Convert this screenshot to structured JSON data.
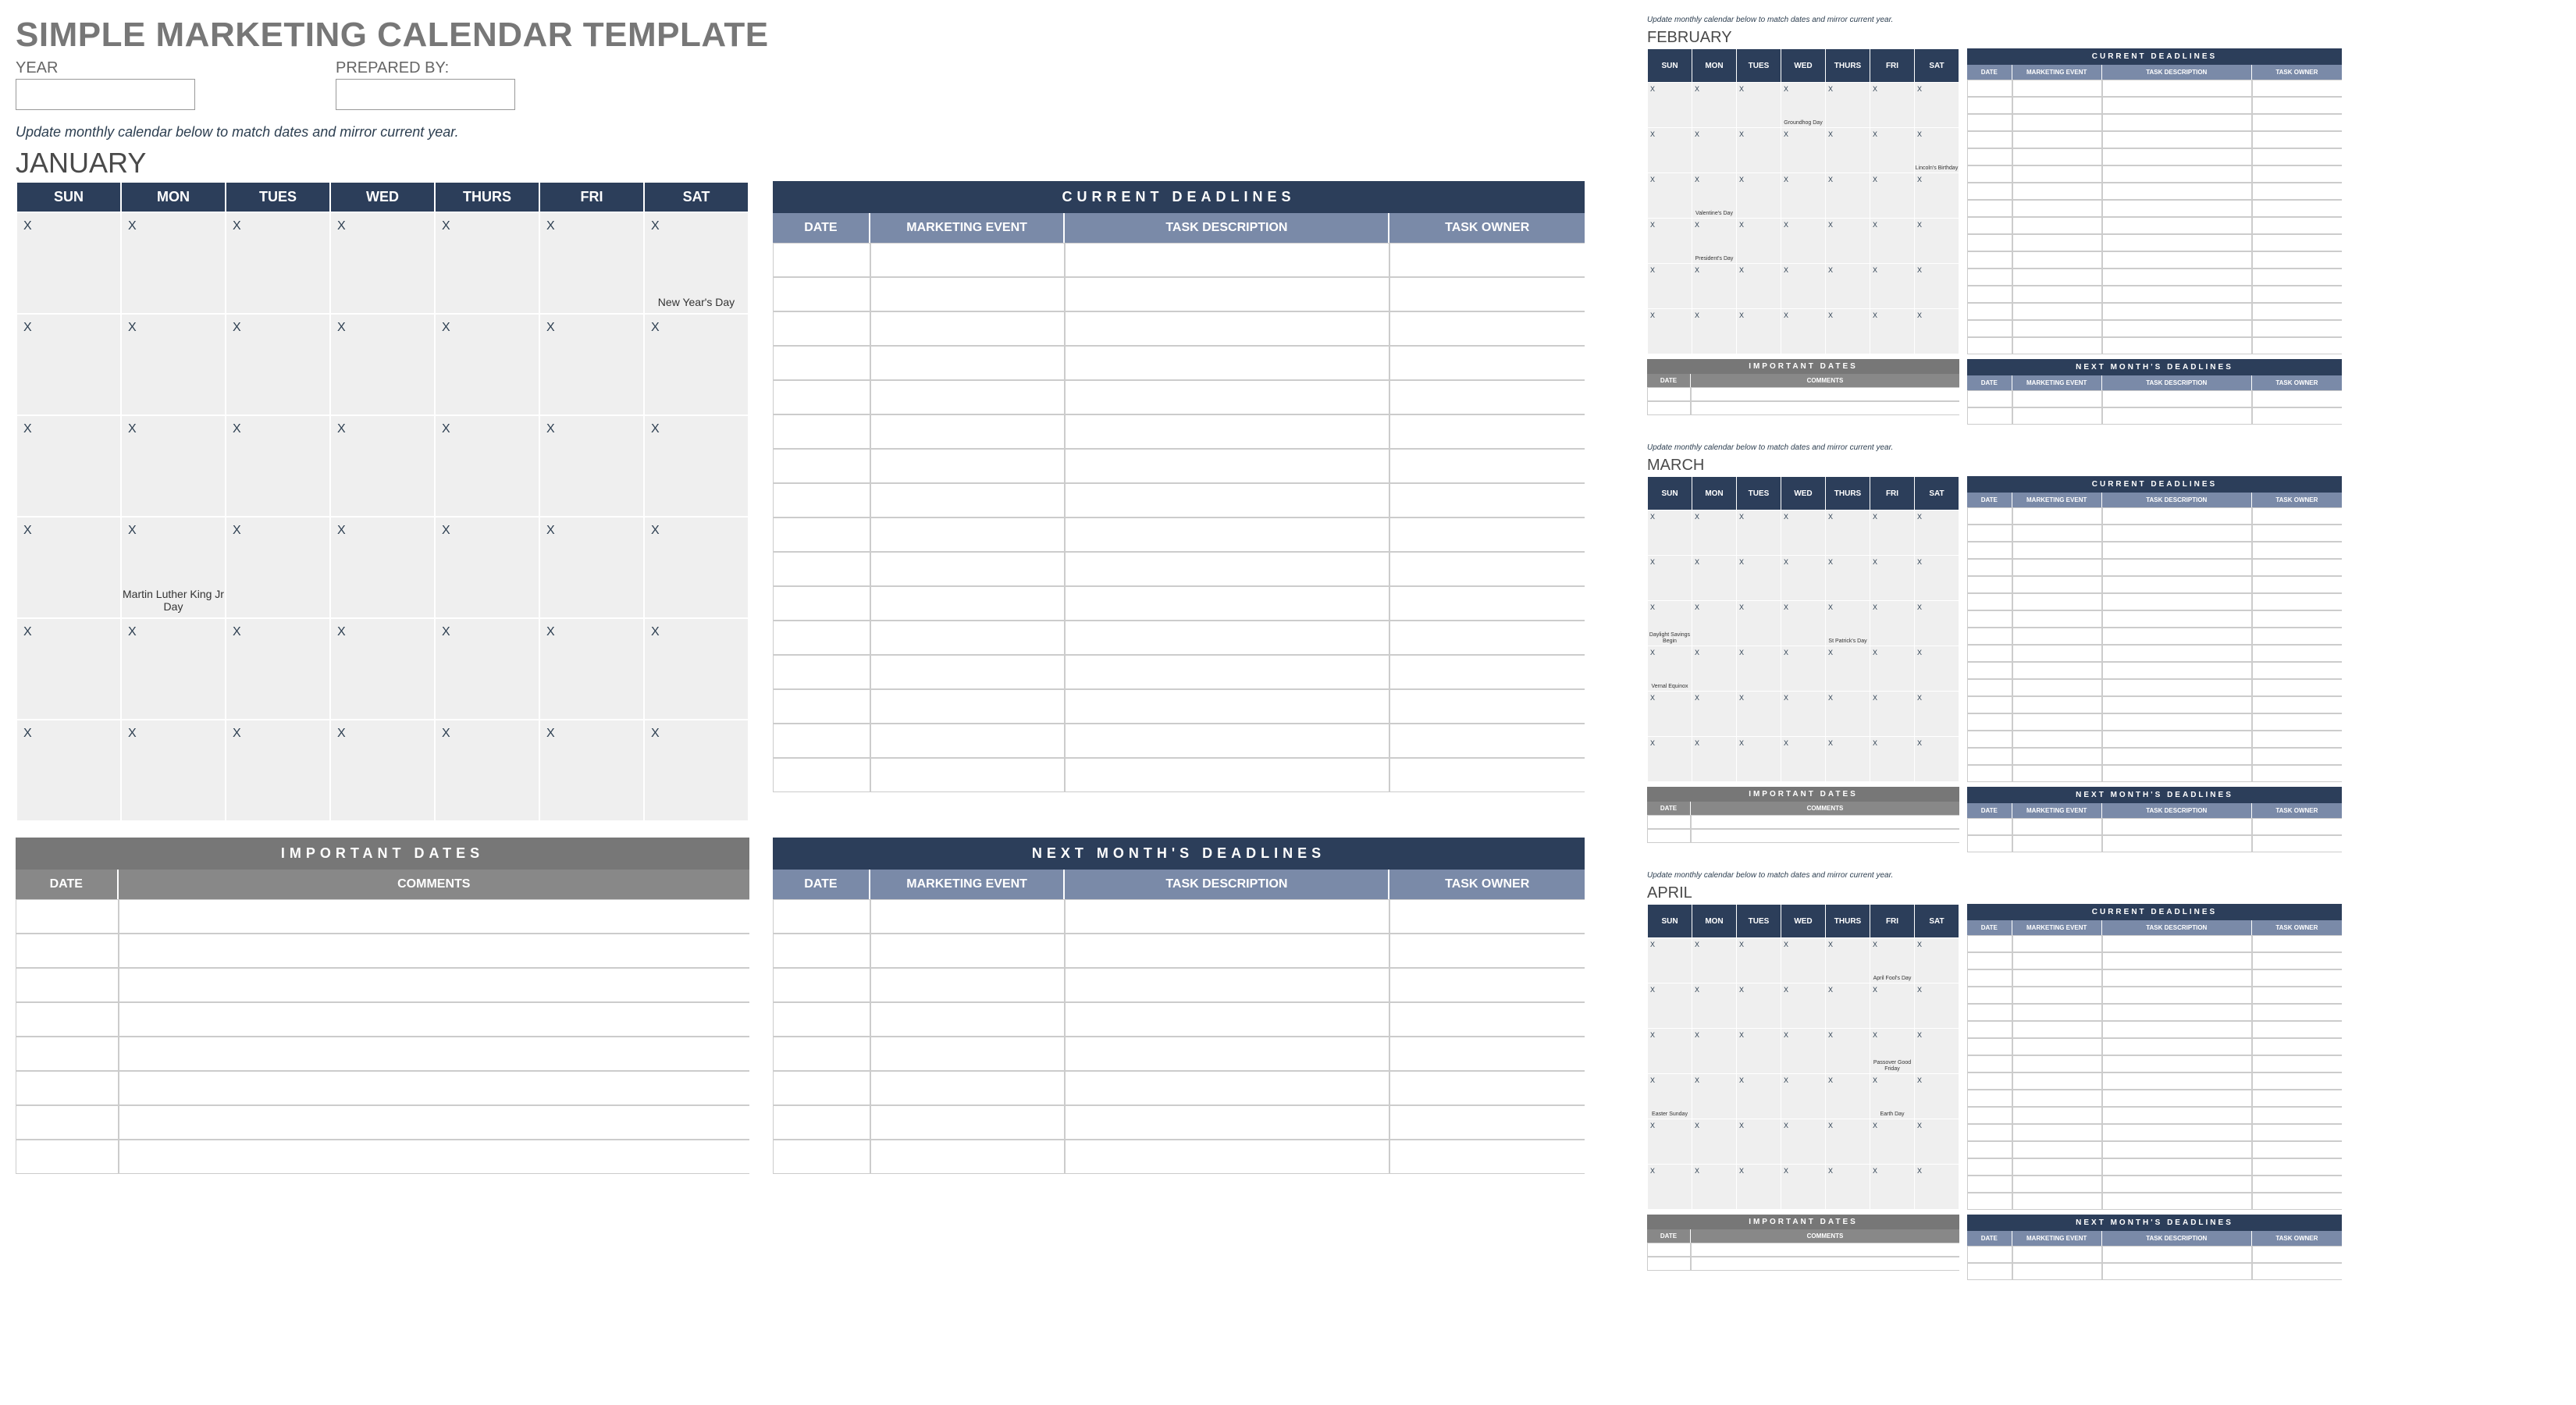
{
  "title": "SIMPLE MARKETING CALENDAR TEMPLATE",
  "meta": {
    "year_label": "YEAR",
    "year_value": "",
    "prepared_label": "PREPARED BY:",
    "prepared_value": ""
  },
  "instruction": "Update monthly calendar below to match dates and mirror current year.",
  "day_headers": [
    "SUN",
    "MON",
    "TUES",
    "WED",
    "THURS",
    "FRI",
    "SAT"
  ],
  "panel_labels": {
    "current_deadlines": "CURRENT DEADLINES",
    "next_month_deadlines": "NEXT MONTH'S DEADLINES",
    "important_dates": "IMPORTANT DATES",
    "date": "DATE",
    "marketing_event": "MARKETING EVENT",
    "task_description": "TASK DESCRIPTION",
    "task_owner": "TASK OWNER",
    "comments": "COMMENTS"
  },
  "main_month": {
    "name": "JANUARY",
    "weeks": [
      [
        {
          "m": "X"
        },
        {
          "m": "X"
        },
        {
          "m": "X"
        },
        {
          "m": "X"
        },
        {
          "m": "X"
        },
        {
          "m": "X"
        },
        {
          "m": "X",
          "ev": "New Year's Day"
        }
      ],
      [
        {
          "m": "X"
        },
        {
          "m": "X"
        },
        {
          "m": "X"
        },
        {
          "m": "X"
        },
        {
          "m": "X"
        },
        {
          "m": "X"
        },
        {
          "m": "X"
        }
      ],
      [
        {
          "m": "X"
        },
        {
          "m": "X"
        },
        {
          "m": "X"
        },
        {
          "m": "X"
        },
        {
          "m": "X"
        },
        {
          "m": "X"
        },
        {
          "m": "X"
        }
      ],
      [
        {
          "m": "X"
        },
        {
          "m": "X",
          "ev": "Martin Luther King Jr Day"
        },
        {
          "m": "X"
        },
        {
          "m": "X"
        },
        {
          "m": "X"
        },
        {
          "m": "X"
        },
        {
          "m": "X"
        }
      ],
      [
        {
          "m": "X"
        },
        {
          "m": "X"
        },
        {
          "m": "X"
        },
        {
          "m": "X"
        },
        {
          "m": "X"
        },
        {
          "m": "X"
        },
        {
          "m": "X"
        }
      ],
      [
        {
          "m": "X"
        },
        {
          "m": "X"
        },
        {
          "m": "X"
        },
        {
          "m": "X"
        },
        {
          "m": "X"
        },
        {
          "m": "X"
        },
        {
          "m": "X"
        }
      ]
    ]
  },
  "mini_months": [
    {
      "name": "FEBRUARY",
      "weeks": [
        [
          {
            "m": "X"
          },
          {
            "m": "X"
          },
          {
            "m": "X"
          },
          {
            "m": "X",
            "ev": "Groundhog Day"
          },
          {
            "m": "X"
          },
          {
            "m": "X"
          },
          {
            "m": "X"
          }
        ],
        [
          {
            "m": "X"
          },
          {
            "m": "X"
          },
          {
            "m": "X"
          },
          {
            "m": "X"
          },
          {
            "m": "X"
          },
          {
            "m": "X"
          },
          {
            "m": "X",
            "ev": "Lincoln's Birthday"
          }
        ],
        [
          {
            "m": "X"
          },
          {
            "m": "X",
            "ev": "Valentine's Day"
          },
          {
            "m": "X"
          },
          {
            "m": "X"
          },
          {
            "m": "X"
          },
          {
            "m": "X"
          },
          {
            "m": "X"
          }
        ],
        [
          {
            "m": "X"
          },
          {
            "m": "X",
            "ev": "President's Day"
          },
          {
            "m": "X"
          },
          {
            "m": "X"
          },
          {
            "m": "X"
          },
          {
            "m": "X"
          },
          {
            "m": "X"
          }
        ],
        [
          {
            "m": "X"
          },
          {
            "m": "X"
          },
          {
            "m": "X"
          },
          {
            "m": "X"
          },
          {
            "m": "X"
          },
          {
            "m": "X"
          },
          {
            "m": "X"
          }
        ],
        [
          {
            "m": "X"
          },
          {
            "m": "X"
          },
          {
            "m": "X"
          },
          {
            "m": "X"
          },
          {
            "m": "X"
          },
          {
            "m": "X"
          },
          {
            "m": "X"
          }
        ]
      ]
    },
    {
      "name": "MARCH",
      "weeks": [
        [
          {
            "m": "X"
          },
          {
            "m": "X"
          },
          {
            "m": "X"
          },
          {
            "m": "X"
          },
          {
            "m": "X"
          },
          {
            "m": "X"
          },
          {
            "m": "X"
          }
        ],
        [
          {
            "m": "X"
          },
          {
            "m": "X"
          },
          {
            "m": "X"
          },
          {
            "m": "X"
          },
          {
            "m": "X"
          },
          {
            "m": "X"
          },
          {
            "m": "X"
          }
        ],
        [
          {
            "m": "X",
            "ev": "Daylight Savings Begin"
          },
          {
            "m": "X"
          },
          {
            "m": "X"
          },
          {
            "m": "X"
          },
          {
            "m": "X",
            "ev": "St Patrick's Day"
          },
          {
            "m": "X"
          },
          {
            "m": "X"
          }
        ],
        [
          {
            "m": "X",
            "ev": "Vernal Equinox"
          },
          {
            "m": "X"
          },
          {
            "m": "X"
          },
          {
            "m": "X"
          },
          {
            "m": "X"
          },
          {
            "m": "X"
          },
          {
            "m": "X"
          }
        ],
        [
          {
            "m": "X"
          },
          {
            "m": "X"
          },
          {
            "m": "X"
          },
          {
            "m": "X"
          },
          {
            "m": "X"
          },
          {
            "m": "X"
          },
          {
            "m": "X"
          }
        ],
        [
          {
            "m": "X"
          },
          {
            "m": "X"
          },
          {
            "m": "X"
          },
          {
            "m": "X"
          },
          {
            "m": "X"
          },
          {
            "m": "X"
          },
          {
            "m": "X"
          }
        ]
      ]
    },
    {
      "name": "APRIL",
      "weeks": [
        [
          {
            "m": "X"
          },
          {
            "m": "X"
          },
          {
            "m": "X"
          },
          {
            "m": "X"
          },
          {
            "m": "X"
          },
          {
            "m": "X",
            "ev": "April Fool's Day"
          },
          {
            "m": "X"
          }
        ],
        [
          {
            "m": "X"
          },
          {
            "m": "X"
          },
          {
            "m": "X"
          },
          {
            "m": "X"
          },
          {
            "m": "X"
          },
          {
            "m": "X"
          },
          {
            "m": "X"
          }
        ],
        [
          {
            "m": "X"
          },
          {
            "m": "X"
          },
          {
            "m": "X"
          },
          {
            "m": "X"
          },
          {
            "m": "X"
          },
          {
            "m": "X",
            "ev": "Passover Good Friday"
          },
          {
            "m": "X"
          }
        ],
        [
          {
            "m": "X",
            "ev": "Easter Sunday"
          },
          {
            "m": "X"
          },
          {
            "m": "X"
          },
          {
            "m": "X"
          },
          {
            "m": "X"
          },
          {
            "m": "X",
            "ev": "Earth Day"
          },
          {
            "m": "X"
          }
        ],
        [
          {
            "m": "X"
          },
          {
            "m": "X"
          },
          {
            "m": "X"
          },
          {
            "m": "X"
          },
          {
            "m": "X"
          },
          {
            "m": "X"
          },
          {
            "m": "X"
          }
        ],
        [
          {
            "m": "X"
          },
          {
            "m": "X"
          },
          {
            "m": "X"
          },
          {
            "m": "X"
          },
          {
            "m": "X"
          },
          {
            "m": "X"
          },
          {
            "m": "X"
          }
        ]
      ]
    }
  ]
}
